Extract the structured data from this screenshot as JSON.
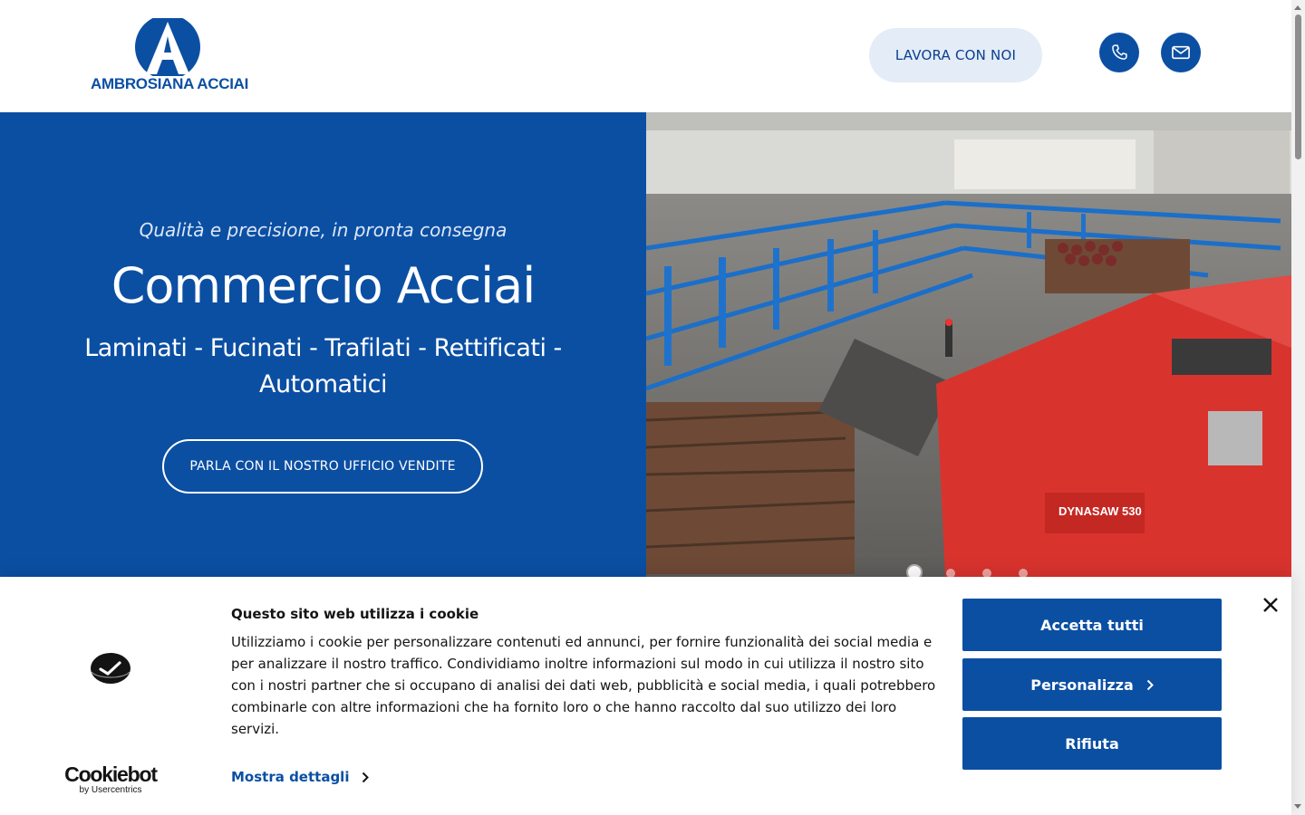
{
  "header": {
    "logo_text": "AMBROSIANA ACCIAI",
    "work_with_us_label": "LAVORA CON NOI",
    "phone_icon": "phone-icon",
    "mail_icon": "mail-icon",
    "brand_color": "#0b4fa3"
  },
  "hero": {
    "tagline": "Qualità e precisione, in pronta consegna",
    "title": "Commercio Acciai",
    "subtitle": "Laminati - Fucinati - Trafilati - Rettificati - Automatici",
    "cta_label": "PARLA CON IL NOSTRO UFFICIO VENDITE",
    "slider": {
      "slide_count": 4,
      "active_slide": 1
    }
  },
  "cookie_banner": {
    "title": "Questo sito web utilizza i cookie",
    "text": "Utilizziamo i cookie per personalizzare contenuti ed annunci, per fornire funzionalità dei social media e per analizzare il nostro traffico. Condividiamo inoltre informazioni sul modo in cui utilizza il nostro sito con i nostri partner che si occupano di analisi dei dati web, pubblicità e social media, i quali potrebbero combinarle con altre informazioni che ha fornito loro o che hanno raccolto dal suo utilizzo dei loro servizi.",
    "details_label": "Mostra dettagli",
    "accept_label": "Accetta tutti",
    "customize_label": "Personalizza",
    "reject_label": "Rifiuta",
    "brand_name": "Cookiebot",
    "brand_by": "by Usercentrics",
    "button_color": "#0b4fa3"
  }
}
